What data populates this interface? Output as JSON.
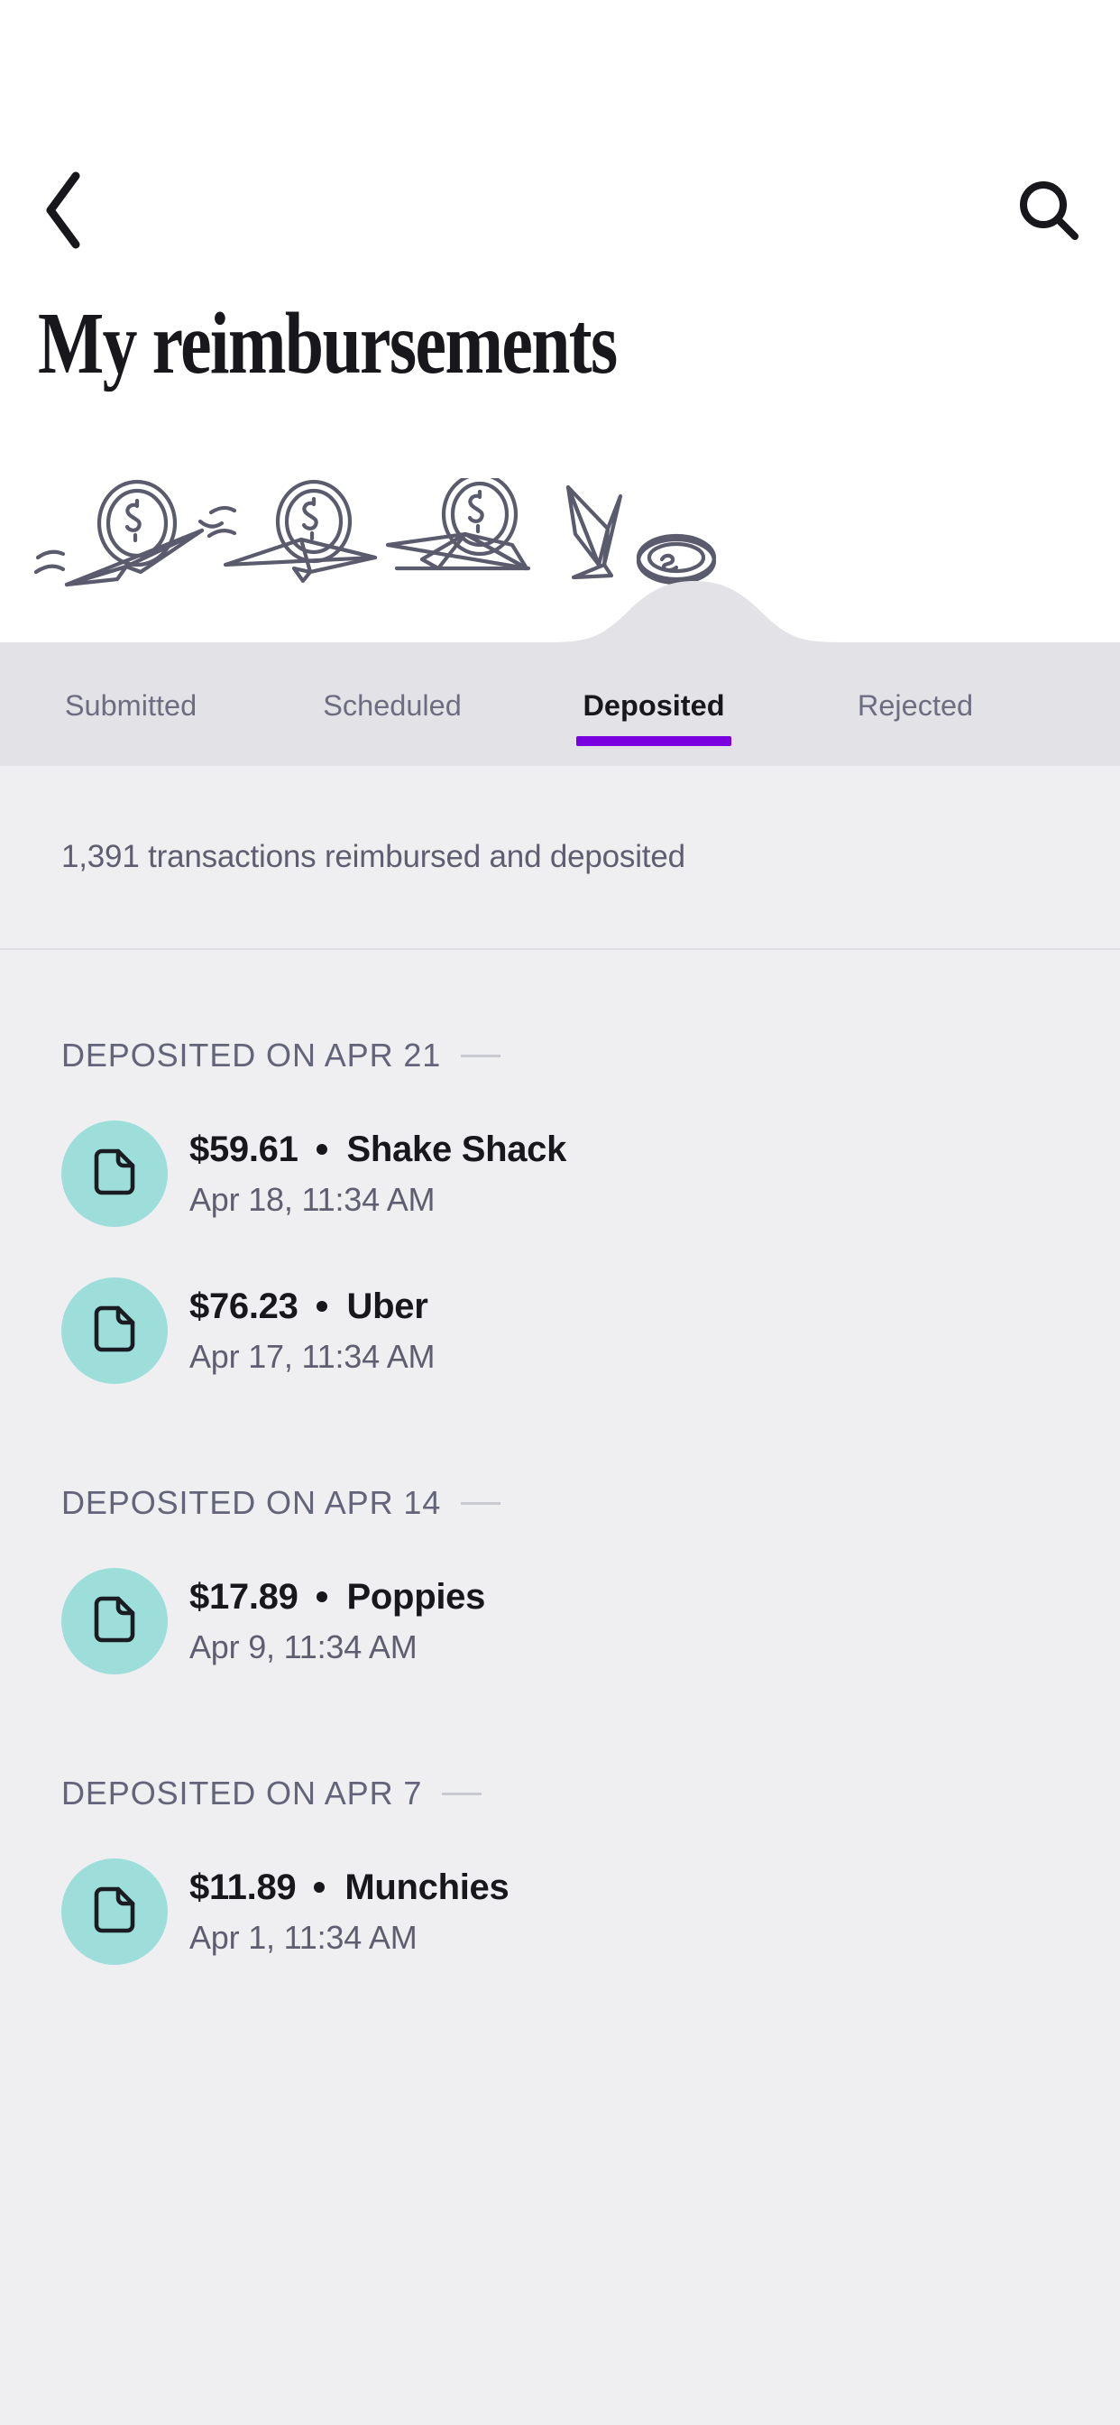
{
  "header": {
    "back_icon": "chevron-left-icon",
    "search_icon": "search-icon",
    "title": "My reimbursements"
  },
  "illustrations": [
    {
      "name": "paper-plane-coin-diving-icon"
    },
    {
      "name": "paper-plane-coin-flying-icon"
    },
    {
      "name": "paper-plane-coin-landing-icon"
    },
    {
      "name": "paper-plane-crashed-coin-icon"
    }
  ],
  "tabs": [
    {
      "label": "Submitted",
      "active": false
    },
    {
      "label": "Scheduled",
      "active": false
    },
    {
      "label": "Deposited",
      "active": true
    },
    {
      "label": "Rejected",
      "active": false
    }
  ],
  "summary": {
    "text": "1,391 transactions reimbursed and deposited",
    "count": "1,391"
  },
  "colors": {
    "accent_purple": "#7B00E0",
    "avatar_teal": "#9DDEDB",
    "tab_bar_bg": "#E3E2E7",
    "page_bg": "#EFEFF1",
    "text_primary": "#17171C",
    "text_secondary": "#5E5E70"
  },
  "groups": [
    {
      "header": "DEPOSITED ON APR 21",
      "rows": [
        {
          "amount": "$59.61",
          "merchant": "Shake Shack",
          "timestamp": "Apr 18, 11:34 AM",
          "icon": "document-icon"
        },
        {
          "amount": "$76.23",
          "merchant": "Uber",
          "timestamp": "Apr 17, 11:34 AM",
          "icon": "document-icon"
        }
      ]
    },
    {
      "header": "DEPOSITED ON APR 14",
      "rows": [
        {
          "amount": "$17.89",
          "merchant": "Poppies",
          "timestamp": "Apr 9, 11:34 AM",
          "icon": "document-icon"
        }
      ]
    },
    {
      "header": "DEPOSITED ON APR 7",
      "rows": [
        {
          "amount": "$11.89",
          "merchant": "Munchies",
          "timestamp": "Apr 1, 11:34 AM",
          "icon": "document-icon"
        }
      ]
    }
  ]
}
